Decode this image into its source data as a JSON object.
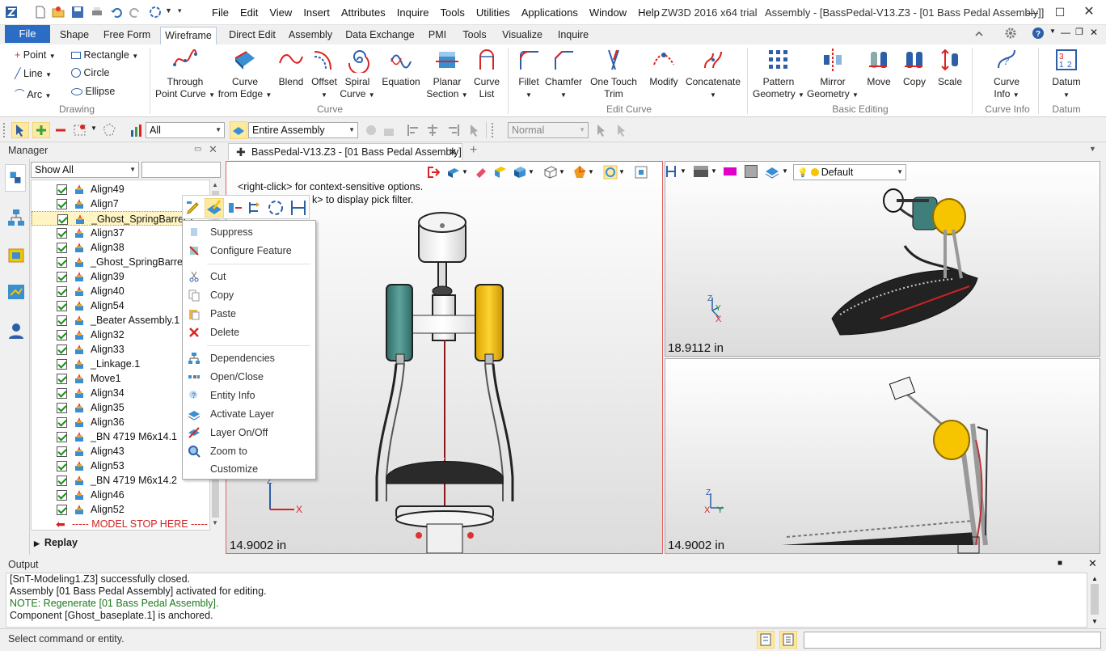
{
  "app": {
    "product": "ZW3D 2016  x64 trial",
    "context": "Assembly - [BassPedal-V13.Z3 - [01 Bass Pedal Assembly]]"
  },
  "menu": [
    "File",
    "Edit",
    "View",
    "Insert",
    "Attributes",
    "Inquire",
    "Tools",
    "Utilities",
    "Applications",
    "Window",
    "Help"
  ],
  "tabs": {
    "file": "File",
    "items": [
      "Shape",
      "Free Form",
      "Wireframe",
      "Direct Edit",
      "Assembly",
      "Data Exchange",
      "PMI",
      "Tools",
      "Visualize",
      "Inquire"
    ],
    "active": "Wireframe"
  },
  "ribbon": {
    "drawing": {
      "label": "Drawing",
      "items": [
        "Point",
        "Rectangle",
        "Line",
        "Circle",
        "Arc",
        "Ellipse"
      ]
    },
    "curve": {
      "label": "Curve",
      "buttons": [
        {
          "l1": "Through",
          "l2": "Point Curve"
        },
        {
          "l1": "Curve",
          "l2": "from Edge"
        },
        {
          "l1": "Blend",
          "l2": ""
        },
        {
          "l1": "Offset",
          "l2": ""
        },
        {
          "l1": "Spiral",
          "l2": "Curve"
        },
        {
          "l1": "Equation",
          "l2": ""
        },
        {
          "l1": "Planar",
          "l2": "Section"
        },
        {
          "l1": "Curve",
          "l2": "List"
        }
      ]
    },
    "edit_curve": {
      "label": "Edit Curve",
      "buttons": [
        {
          "l1": "Fillet",
          "l2": ""
        },
        {
          "l1": "Chamfer",
          "l2": ""
        },
        {
          "l1": "One Touch",
          "l2": "Trim"
        },
        {
          "l1": "Modify",
          "l2": ""
        },
        {
          "l1": "Concatenate",
          "l2": ""
        }
      ]
    },
    "basic_editing": {
      "label": "Basic Editing",
      "buttons": [
        {
          "l1": "Pattern",
          "l2": "Geometry"
        },
        {
          "l1": "Mirror",
          "l2": "Geometry"
        },
        {
          "l1": "Move",
          "l2": ""
        },
        {
          "l1": "Copy",
          "l2": ""
        },
        {
          "l1": "Scale",
          "l2": ""
        }
      ]
    },
    "curve_info": {
      "label": "Curve Info",
      "l1": "Curve",
      "l2": "Info"
    },
    "datum": {
      "label": "Datum",
      "l1": "Datum",
      "l2": ""
    }
  },
  "toolbar": {
    "filter": "All",
    "scope": "Entire Assembly",
    "mode": "Normal"
  },
  "manager": {
    "title": "Manager",
    "show": "Show All",
    "tree": [
      "Align49",
      "Align7",
      "_Ghost_SpringBarrel.1",
      "Align37",
      "Align38",
      "_Ghost_SpringBarrel.2",
      "Align39",
      "Align40",
      "Align54",
      "_Beater Assembly.1",
      "Align32",
      "Align33",
      "_Linkage.1",
      "Move1",
      "Align34",
      "Align35",
      "Align36",
      "_BN 4719 M6x14.1",
      "Align43",
      "Align53",
      "_BN 4719 M6x14.2",
      "Align46",
      "Align52"
    ],
    "stop_label": "----- MODEL STOP HERE -----",
    "replay": "Replay"
  },
  "document_tab": "BassPedal-V13.Z3 - [01 Bass Pedal Assembly]",
  "viewport": {
    "hint1": "<right-click> for context-sensitive options.",
    "hint2": "<ctrl-right-click> to display pick filter.",
    "hint2_visible": "k> to display pick filter.",
    "main_dim": "14.9002 in",
    "tr_dim": "18.9112 in",
    "br_dim": "14.9002 in",
    "style": "Default"
  },
  "context_menu": {
    "items": [
      "Suppress",
      "Configure Feature",
      "Cut",
      "Copy",
      "Paste",
      "Delete",
      "Dependencies",
      "Open/Close",
      "Entity Info",
      "Activate Layer",
      "Layer On/Off",
      "Zoom to",
      "Customize"
    ]
  },
  "output": {
    "title": "Output",
    "lines": [
      "[SnT-Modeling1.Z3] successfully closed.",
      "Assembly [01 Bass Pedal Assembly] activated for editing.",
      "NOTE: Regenerate [01 Bass Pedal Assembly].",
      "Component [Ghost_baseplate.1] is anchored."
    ]
  },
  "status": {
    "prompt": "Select command or entity."
  },
  "colors": {
    "file_tab": "#2b6cc4",
    "note_text": "#1a7a1a",
    "stop_text": "#d42020",
    "active_view_border": "#e06060",
    "yellow_part": "#f7c400",
    "teal_part": "#3f7f7b"
  }
}
